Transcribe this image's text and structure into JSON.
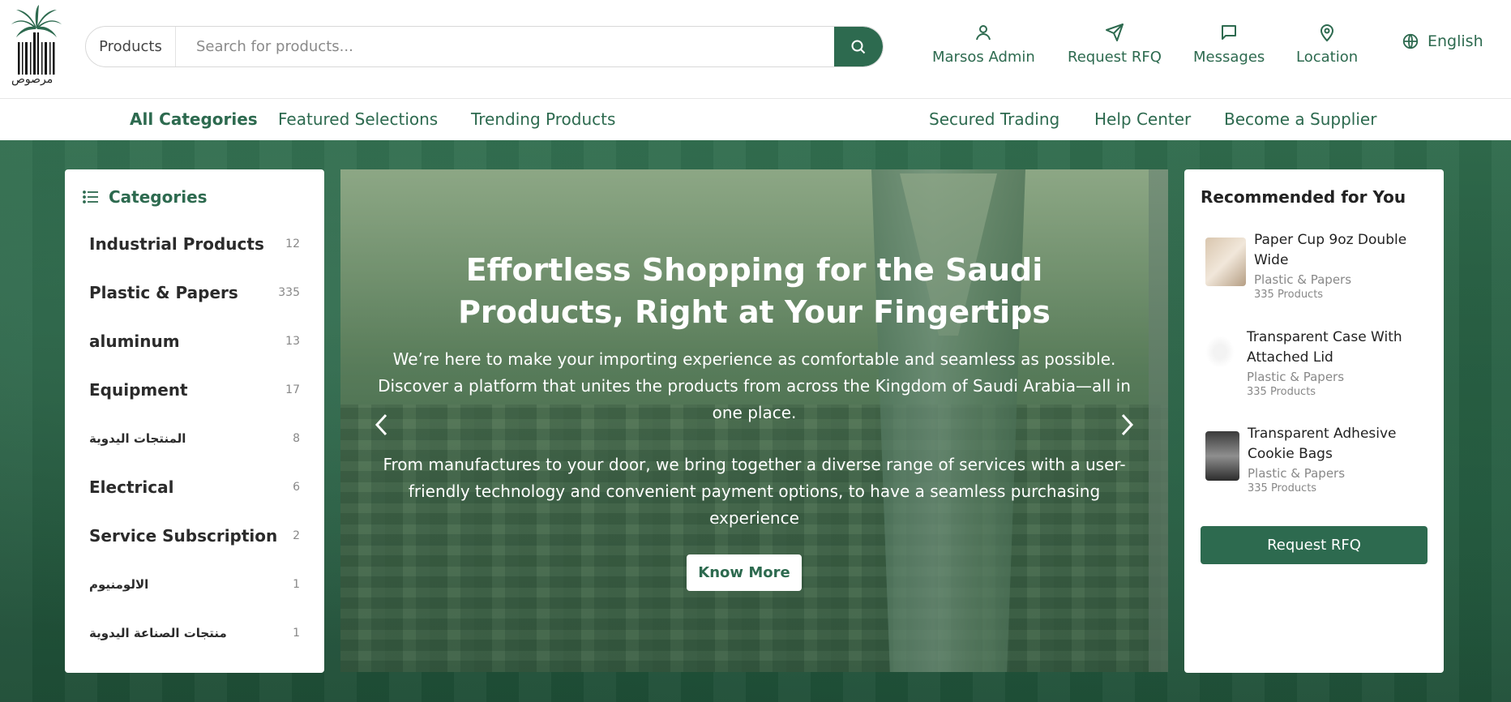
{
  "brand": {
    "logo_text": "مرصوص"
  },
  "search": {
    "category": "Products",
    "placeholder": "Search for products..."
  },
  "header_nav": [
    {
      "label": "Marsos Admin",
      "icon": "user-icon"
    },
    {
      "label": "Request RFQ",
      "icon": "send-icon"
    },
    {
      "label": "Messages",
      "icon": "message-icon"
    },
    {
      "label": "Location",
      "icon": "location-pin-icon"
    }
  ],
  "language": {
    "label": "English",
    "icon": "globe-icon"
  },
  "nav": {
    "left": [
      "All Categories",
      "Featured Selections",
      "Trending Products"
    ],
    "right": [
      "Secured Trading",
      "Help Center",
      "Become a Supplier"
    ]
  },
  "categories": {
    "title": "Categories",
    "items": [
      {
        "name": "Industrial Products",
        "count": "12"
      },
      {
        "name": "Plastic & Papers",
        "count": "335"
      },
      {
        "name": "aluminum",
        "count": "13"
      },
      {
        "name": "Equipment",
        "count": "17"
      },
      {
        "name": "المنتجات اليدوية",
        "count": "8"
      },
      {
        "name": "Electrical",
        "count": "6"
      },
      {
        "name": "Service Subscription",
        "count": "2"
      },
      {
        "name": "الالومنيوم",
        "count": "1"
      },
      {
        "name": "منتجات الصناعة اليدوية",
        "count": "1"
      }
    ]
  },
  "hero": {
    "title": "Effortless Shopping for the Saudi Products, Right at Your Fingertips",
    "p1": "We’re here to make your importing experience as comfortable and seamless as possible. Discover a platform that unites the products from across the Kingdom of Saudi Arabia—all in one place.",
    "p2": "From manufactures to your door, we bring together a diverse range of services with a user-friendly technology and convenient payment options, to have a seamless purchasing experience",
    "button": "Know More"
  },
  "recommended": {
    "title": "Recommended for You",
    "items": [
      {
        "name": "Paper Cup 9oz Double Wide",
        "category": "Plastic & Papers",
        "count": "335 Products"
      },
      {
        "name": "Transparent Case With Attached Lid",
        "category": "Plastic & Papers",
        "count": "335 Products"
      },
      {
        "name": "Transparent Adhesive Cookie Bags",
        "category": "Plastic & Papers",
        "count": "335 Products"
      }
    ],
    "button": "Request RFQ"
  },
  "colors": {
    "primary": "#2d6a4f",
    "panel": "#ffffff"
  }
}
